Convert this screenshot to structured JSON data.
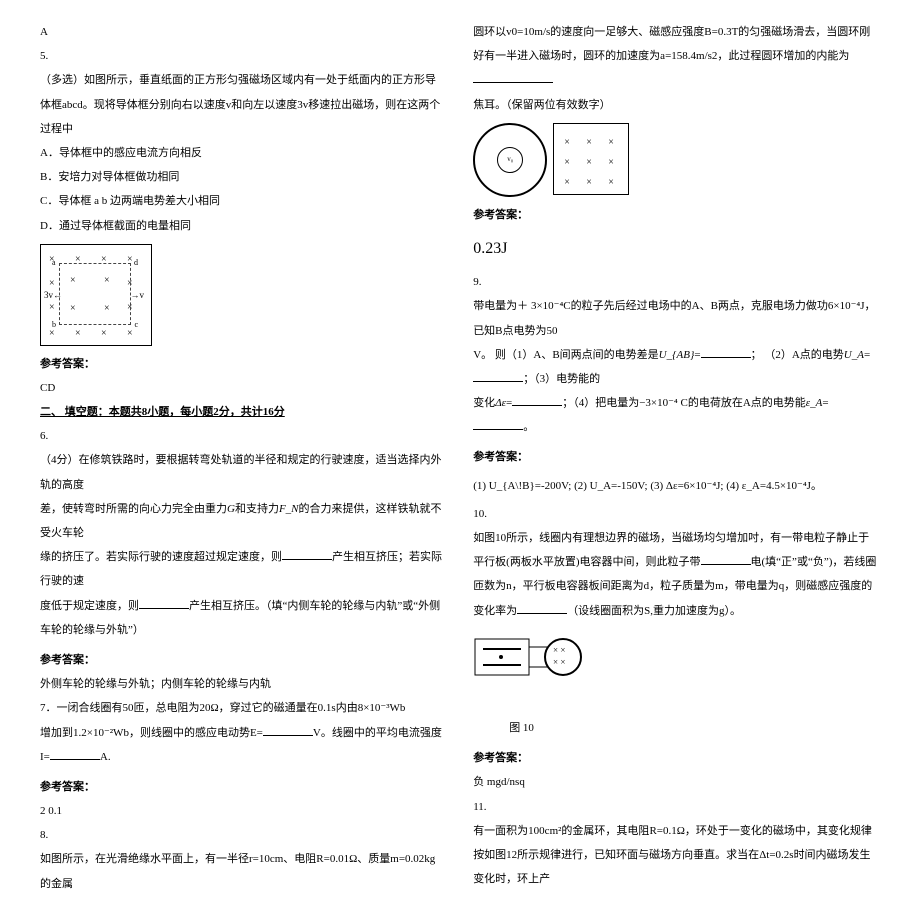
{
  "left": {
    "a_letter": "A",
    "q5_num": "5.",
    "q5_stem1": " （多选）如图所示，垂直纸面的正方形匀强磁场区域内有一处于纸面内的正方形导体框abcd。现将导体框分别向右以速度v和向左以速度3v移速拉出磁场，则在这两个过程中",
    "q5_A": "A．导体框中的感应电流方向相反",
    "q5_B": "B．安培力对导体框做功相同",
    "q5_C": "C．导体框 a  b 边两端电势差大小相同",
    "q5_D": "D．通过导体框截面的电量相同",
    "ans_label": "参考答案：",
    "q5_ans": "CD",
    "section2": "二、 填空题：本题共8小题，每小题2分，共计16分",
    "q6_num": "6.",
    "q6_stem1": " （4分）在修筑铁路时，要根据转弯处轨道的半径和规定的行驶速度，适当选择内外轨的高度",
    "q6_stem2a": "差，使转弯时所需的向心力完全由重力",
    "q6_G": "G",
    "q6_stem2b": "和支持力",
    "q6_FN": "F_N",
    "q6_stem2c": "的合力来提供，这样铁轨就不受火车轮",
    "q6_stem3": "缘的挤压了。若实际行驶的速度超过规定速度，则",
    "q6_blank_mid": "产生相互挤压；若实际行驶的速",
    "q6_stem4": "度低于规定速度，则",
    "q6_stem4b": "产生相互挤压。（填“内侧车轮的轮缘与内轨”或“外侧车轮的轮缘与外轨”）",
    "q6_ans": "外侧车轮的轮缘与外轨；内侧车轮的轮缘与内轨",
    "q7": "7．一闭合线圈有50匝，总电阻为20Ω，穿过它的磁通量在0.1s内由",
    "q7_val1": "8×10⁻³Wb",
    "q7_b": "增加到",
    "q7_val2": "1.2×10⁻²Wb",
    "q7_c": "，则线圈中的感应电动势E=",
    "q7_d": "V。线圈中的平均电流强度",
    "q7_I": "I=",
    "q7_Iu": "A.",
    "q7_ans": "2   0.1",
    "q8_num": "8.",
    "q8_stem": "如图所示，在光滑绝缘水平面上，有一半径r=10cm、电阻R=0.01Ω、质量m=0.02kg的金属"
  },
  "right": {
    "q8_cont": "圆环以v0=10m/s的速度向一足够大、磁感应强度B=0.3T的匀强磁场滑去，当圆环刚好有一半进入磁场时，圆环的加速度为a=158.4m/s2，此过程圆环增加的内能为",
    "q8_tail": "焦耳。（保留两位有效数字）",
    "ans_label": "参考答案：",
    "q8_ans": "0.23J",
    "q9_num": "9.",
    "q9_1a": "带电量为＋",
    "q9_3e4": " 3×10⁻⁴",
    "q9_1b": "C的粒子先后经过电场中的A、B两点，克服电场力做功",
    "q9_6e4": "6×10⁻⁴",
    "q9_1c": "J，已知B点电势为50",
    "q9_2": "V。  则（1）A、B间两点间的电势差是",
    "q9_UAB": "U_{AB}",
    "q9_eq": "=",
    "q9_2b": "； （2）A点的电势",
    "q9_UA": "U_A",
    "q9_2c": "=",
    "q9_2d": "；（3）电势能的",
    "q9_3": "变化",
    "q9_dEp": "Δε",
    "q9_3b": "=",
    "q9_3c": "；（4）把电量为",
    "q9_neg3e4": "−3×10⁻⁴",
    "q9_3d": " C的电荷放在A点的电势能",
    "q9_epsA": "ε_A",
    "q9_3e": "=",
    "q9_3f": "。",
    "q9_ans": "(1)  U_{A\\!B}=-200V; (2) U_A=-150V; (3) Δε=6×10⁻⁴J; (4) ε_A=4.5×10⁻⁴J。",
    "q10_num": "10.",
    "q10_stem": "如图10所示，线圈内有理想边界的磁场，当磁场均匀增加吋，有一带电粒子静止于平行板(两板水平放置)电容器中间，则此粒子带",
    "q10_posneg": "电(填“正”或“负”)，若线圈匝数为n，平行板电容器板间距离为d，粒子质量为m，带电量为q，则磁感应强度的变化率为",
    "q10_tail": "（设线圈面积为S,重力加速度为g）。",
    "fig10_label": "图 10",
    "q10_ans": "负     mgd/nsq",
    "q11_num": "11.",
    "q11_stem_a": "有一面积为100cm²的金属环，其电阻",
    "q11_R": "R=0.1Ω",
    "q11_stem_b": "，环处于一变化的磁场中，其变化规律按如图12所示规律进行，已知环面与磁场方向垂直。求当在",
    "q11_dt": "Δt=0.2s",
    "q11_stem_c": "时间内磁场发生变化时，环上产"
  }
}
